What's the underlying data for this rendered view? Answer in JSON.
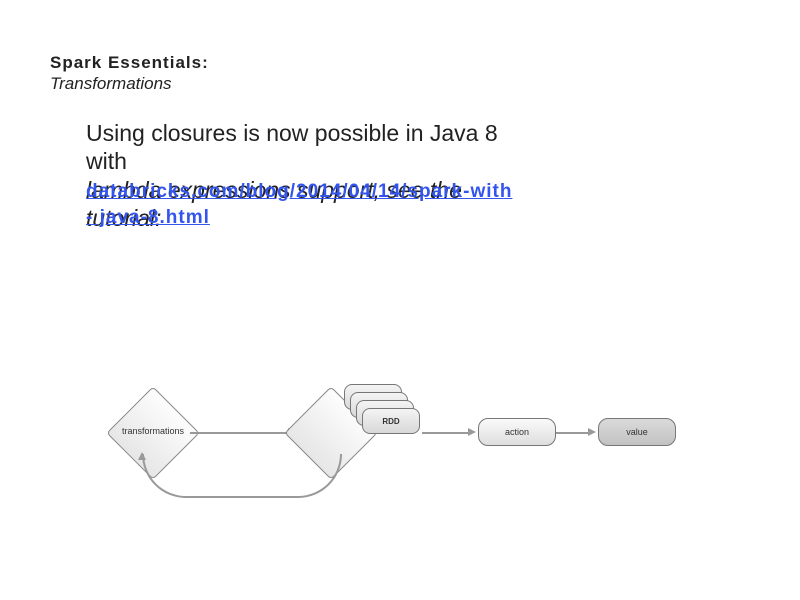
{
  "header": {
    "title": "Spark Essentials:",
    "subtitle": "Transformations"
  },
  "body": {
    "line1": "Using closures is now possible in Java 8",
    "line2": "with",
    "italic_line3": "lambda expressions support, see the",
    "italic_line4": "tutorial:",
    "link_line1": "databricks.com/blog/2014/04/14/spark-with",
    "link_line2": "- java-8.html"
  },
  "diagram": {
    "transformations_label": "transformations",
    "rdd_label": "RDD",
    "action_label": "action",
    "value_label": "value"
  }
}
